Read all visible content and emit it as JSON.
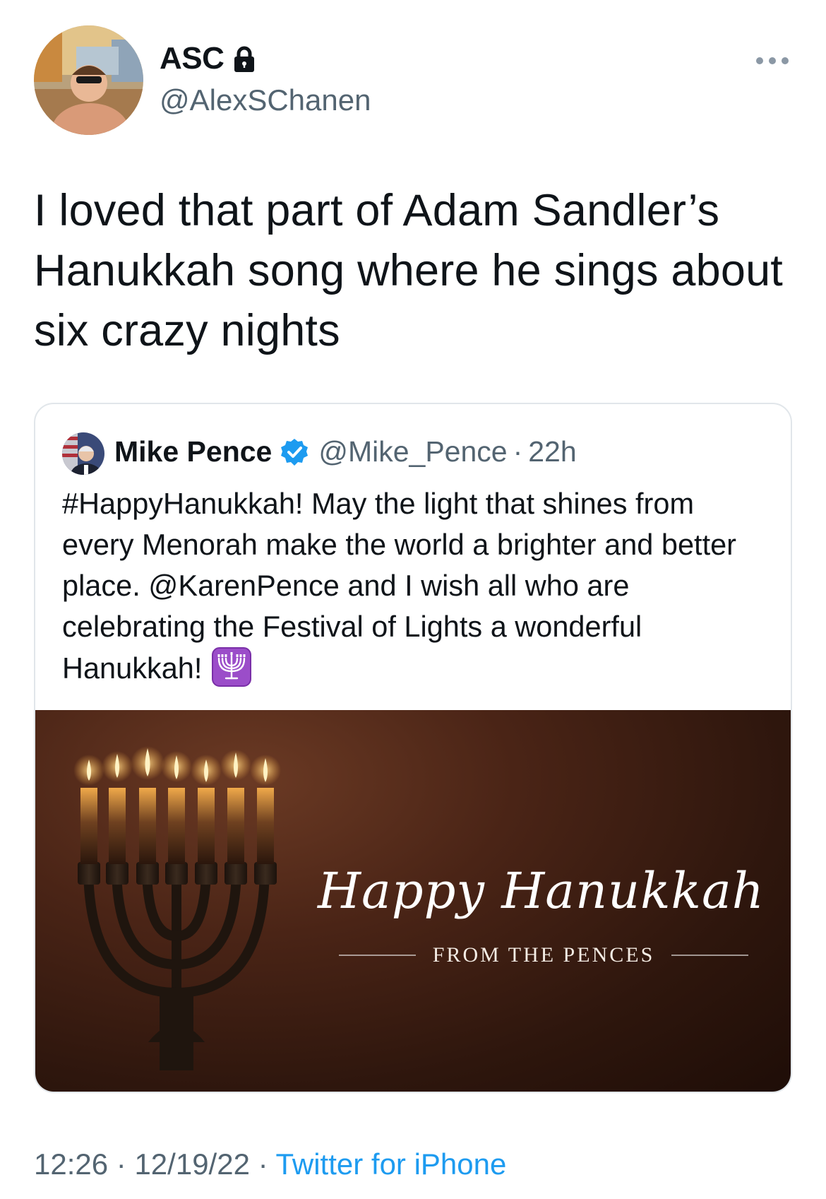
{
  "tweet": {
    "display_name": "ASC",
    "handle": "@AlexSChanen",
    "text": "I loved that part of Adam Sandler’s Hanukkah song where he sings about six crazy nights",
    "time": "12:26",
    "date": "12/19/22",
    "source": "Twitter for iPhone",
    "separator": "·"
  },
  "quoted": {
    "display_name": "Mike Pence",
    "handle": "@Mike_Pence",
    "age": "22h",
    "separator": "·",
    "text": "#HappyHanukkah! May the light that shines from every Menorah make the world a brighter and better place. @KarenPence and I wish all who are celebrating the Festival of Lights a wonderful Hanukkah!",
    "image": {
      "headline": "Happy Hanukkah",
      "subline": "FROM THE PENCES"
    }
  },
  "icons": {
    "lock": "lock-icon",
    "more": "more-icon",
    "verified": "verified-badge-icon",
    "menorah_emoji": "menorah-emoji"
  },
  "colors": {
    "link": "#1d9bf0",
    "secondary_text": "#536471",
    "primary_text": "#0f1419",
    "emoji_bg": "#9b4dc9"
  }
}
